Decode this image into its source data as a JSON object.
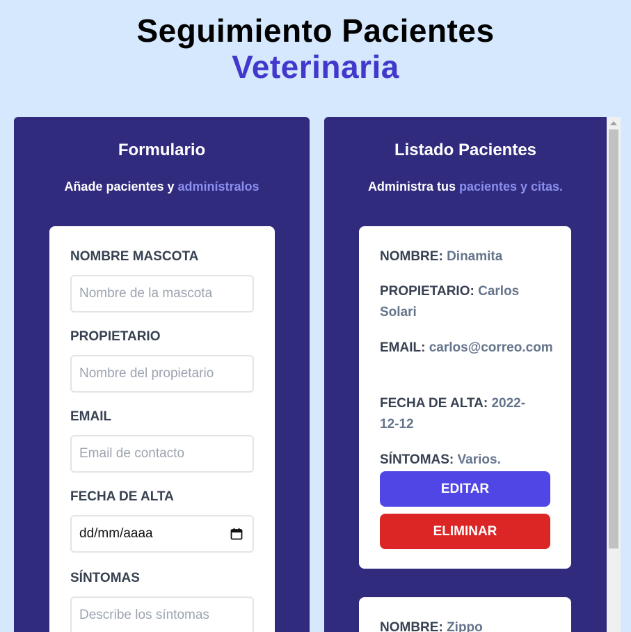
{
  "header": {
    "title_line1": "Seguimiento Pacientes",
    "title_line2": "Veterinaria"
  },
  "form_panel": {
    "title": "Formulario",
    "subtitle_prefix": "Añade pacientes y ",
    "subtitle_accent": "adminístralos",
    "fields": {
      "pet_name": {
        "label": "NOMBRE MASCOTA",
        "placeholder": "Nombre de la mascota"
      },
      "owner": {
        "label": "PROPIETARIO",
        "placeholder": "Nombre del propietario"
      },
      "email": {
        "label": "EMAIL",
        "placeholder": "Email de contacto"
      },
      "discharge_date": {
        "label": "FECHA DE ALTA",
        "value": "dd/mm/aaaa"
      },
      "symptoms": {
        "label": "SÍNTOMAS",
        "placeholder": "Describe los síntomas"
      }
    }
  },
  "list_panel": {
    "title": "Listado Pacientes",
    "subtitle_prefix": "Administra tus ",
    "subtitle_accent": "pacientes y citas.",
    "patients": [
      {
        "name_label": "NOMBRE:",
        "name": "Dinamita",
        "owner_label": "PROPIETARIO:",
        "owner": "Carlos Solari",
        "email_label": "EMAIL:",
        "email": "carlos@correo.com",
        "date_label": "FECHA DE ALTA:",
        "date": "2022-12-12",
        "symptoms_label": "SÍNTOMAS:",
        "symptoms": "Varios.",
        "edit_label": "EDITAR",
        "delete_label": "ELIMINAR"
      },
      {
        "name_label": "NOMBRE:",
        "name": "Zippo"
      }
    ]
  },
  "colors": {
    "background": "#d5e8fd",
    "panel": "#312b7e",
    "accent_title": "#4238cc",
    "accent_text": "#8a8ff0",
    "edit_button": "#4f46e5",
    "delete_button": "#dc2626"
  },
  "icons": {
    "date_picker": "calendar-icon"
  }
}
